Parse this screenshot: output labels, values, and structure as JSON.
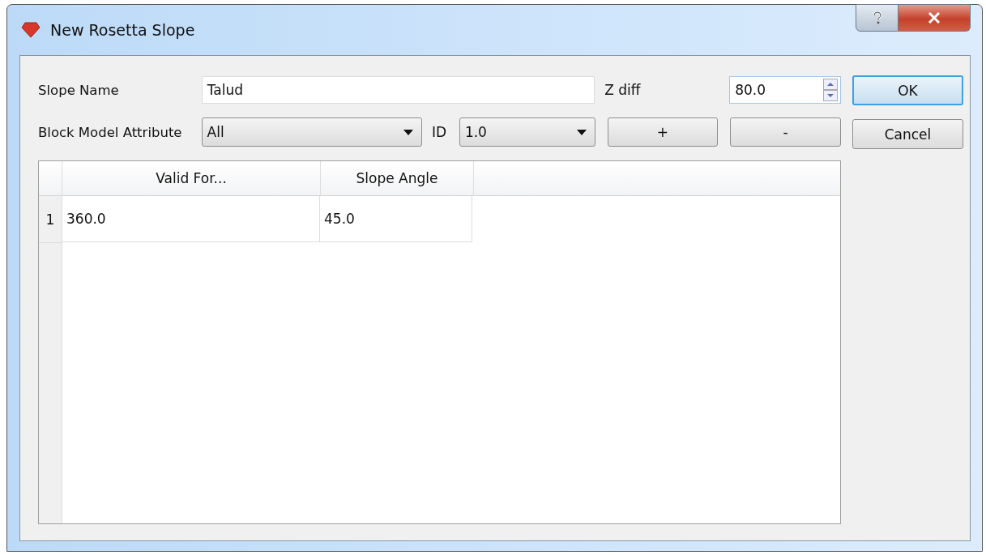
{
  "window": {
    "title": "New Rosetta Slope"
  },
  "slope_name": {
    "label": "Slope Name",
    "value": "Talud"
  },
  "z_diff": {
    "label": "Z diff",
    "value": "80.0"
  },
  "attribute": {
    "label": "Block Model Attribute",
    "value": "All"
  },
  "id": {
    "label": "ID",
    "value": "1.0"
  },
  "row_buttons": [
    "+",
    "-"
  ],
  "dialog_buttons": [
    {
      "label": "OK",
      "default": true
    },
    {
      "label": "Cancel",
      "default": false
    }
  ],
  "table": {
    "columns": [
      "Valid For...",
      "Slope Angle"
    ],
    "rows": [
      {
        "number": "1",
        "cells": [
          "360.0",
          "45.0"
        ]
      }
    ]
  }
}
